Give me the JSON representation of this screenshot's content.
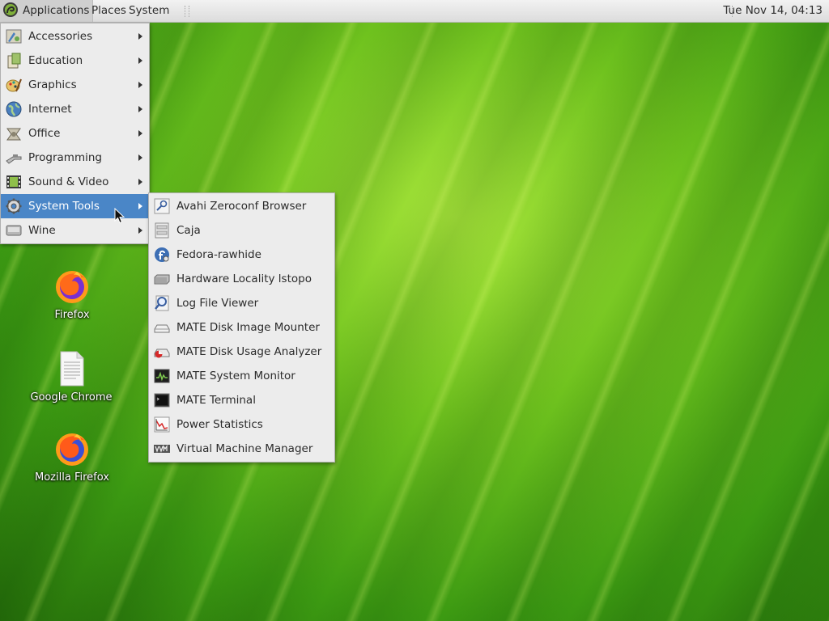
{
  "panel": {
    "applications": "Applications",
    "places": "Places",
    "system": "System",
    "clock": "Tue Nov 14, 04:13"
  },
  "apps_menu": [
    {
      "label": "Accessories",
      "icon": "accessories-icon"
    },
    {
      "label": "Education",
      "icon": "education-icon"
    },
    {
      "label": "Graphics",
      "icon": "graphics-icon"
    },
    {
      "label": "Internet",
      "icon": "internet-icon"
    },
    {
      "label": "Office",
      "icon": "office-icon"
    },
    {
      "label": "Programming",
      "icon": "programming-icon"
    },
    {
      "label": "Sound & Video",
      "icon": "sound-video-icon"
    },
    {
      "label": "System Tools",
      "icon": "system-tools-icon",
      "active": true
    },
    {
      "label": "Wine",
      "icon": "wine-icon"
    }
  ],
  "system_tools_menu": [
    {
      "label": "Avahi Zeroconf Browser",
      "icon": "avahi-icon"
    },
    {
      "label": "Caja",
      "icon": "caja-icon"
    },
    {
      "label": "Fedora-rawhide",
      "icon": "fedora-icon"
    },
    {
      "label": "Hardware Locality lstopo",
      "icon": "hardware-icon"
    },
    {
      "label": "Log File Viewer",
      "icon": "log-viewer-icon"
    },
    {
      "label": "MATE Disk Image Mounter",
      "icon": "disk-image-icon"
    },
    {
      "label": "MATE Disk Usage Analyzer",
      "icon": "disk-usage-icon"
    },
    {
      "label": "MATE System Monitor",
      "icon": "system-monitor-icon"
    },
    {
      "label": "MATE Terminal",
      "icon": "terminal-icon"
    },
    {
      "label": "Power Statistics",
      "icon": "power-statistics-icon"
    },
    {
      "label": "Virtual Machine Manager",
      "icon": "vm-manager-icon"
    }
  ],
  "desktop_icons": [
    {
      "label": "Firefox",
      "icon": "firefox-icon"
    },
    {
      "label": "Google Chrome",
      "icon": "document-icon"
    },
    {
      "label": "Mozilla Firefox",
      "icon": "firefox-icon"
    }
  ],
  "colors": {
    "menu_highlight": "#4a86c7",
    "menu_background": "#ececec",
    "panel_background": "#e6e6e6"
  }
}
